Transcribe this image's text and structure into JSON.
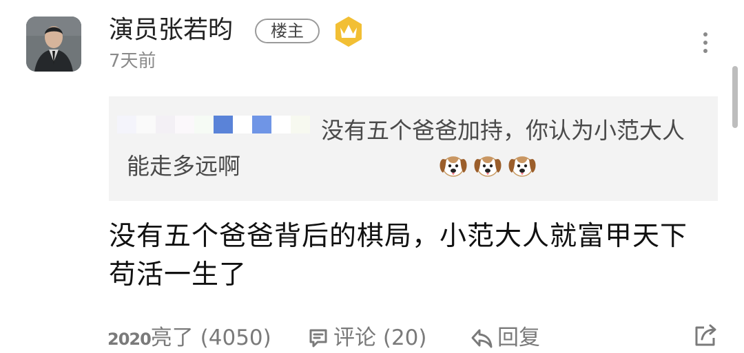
{
  "author": {
    "name": "演员张若昀",
    "op_badge": "楼主",
    "crown_icon": "crown-icon",
    "timestamp": "7天前"
  },
  "quote": {
    "pixel_colors": [
      "#f4f4fb",
      "#fafafa",
      "#f3f0f5",
      "#fbf8fb",
      "#f6fbf5",
      "#5a83d8",
      "#ffffff",
      "#6f95e6",
      "#ffffff",
      "#f7f9f0"
    ],
    "text": "没有五个爸爸加持，你认为小范大人能走多远啊",
    "emoji_icon": "dog-face-emoji",
    "emoji_count": 3
  },
  "reply": {
    "text": "没有五个爸爸背后的棋局，小范大人就富甲天下苟活一生了"
  },
  "actions": {
    "like_year": "2020",
    "like_label": "亮了 (4050)",
    "comment_label": "评论 (20)",
    "reply_label": "回复",
    "like_icon": "year-badge-icon",
    "comment_icon": "comment-icon",
    "reply_icon": "reply-arrow-icon",
    "share_icon": "share-icon",
    "more_icon": "more-vertical-icon"
  },
  "colors": {
    "quote_background": "#f3f3f3",
    "action_gray": "#7a7a7a",
    "crown_yellow": "#f2bf34"
  }
}
